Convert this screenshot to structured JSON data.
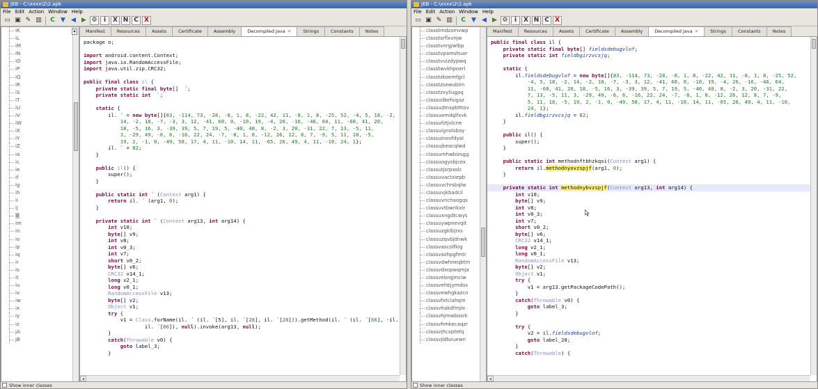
{
  "left_window": {
    "title": "JEB - C:\\xxxx\\2\\2.apk",
    "menu": [
      "File",
      "Edit",
      "Action",
      "Window",
      "Help"
    ],
    "tree_items": [
      "iK",
      "iL",
      "iM",
      "iN",
      "iO",
      "iP",
      "iQ",
      "iR",
      "iS",
      "iT",
      "iU",
      "iV",
      "iW",
      "iX",
      "iY",
      "iZ",
      "ia",
      "ic",
      "ie",
      "if",
      "ig",
      "ih",
      "ii",
      "ij",
      "il",
      "im",
      "in",
      "io",
      "ip",
      "iq",
      "ir",
      "is",
      "it",
      "iu",
      "iv",
      "iw",
      "ix",
      "iy",
      "iz",
      "jA",
      "jB"
    ],
    "tree_selected_index": 24,
    "show_inner_classes": "Show inner classes",
    "tabs": [
      "Manifest",
      "Resources",
      "Assets",
      "Certificate",
      "Assembly",
      "Decompiled Java",
      "Strings",
      "Constants",
      "Notes"
    ],
    "active_tab": 5
  },
  "right_window": {
    "title": "JEB - C:\\xxxx\\2\\2.apk",
    "menu": [
      "File",
      "Edit",
      "Action",
      "Window",
      "Help"
    ],
    "tree_items": [
      "classtmdzamvwp",
      "classtsrflxvnjw",
      "classtvnrgjwlbp",
      "classtvpamshuor",
      "classtvuizdypwq",
      "classtwvkhpoerl",
      "classtzkoemfgcl",
      "classtzsewubirn",
      "classtzvyliugpq",
      "classudkefsigaz",
      "classudmxpbhtov",
      "classuemdqlfxvk",
      "classufztjvlcne",
      "classuignolsbay",
      "classuinovfdyal",
      "classujkeacqlwd",
      "classumhwbizsgg",
      "classuogysbjcex",
      "classutjsrpxolc",
      "classuvactxiepb",
      "classuvchrsbqlw",
      "classuvjkbadcil",
      "classuvnchaogqs",
      "classuvtbwnkxir",
      "classuxngdtcwys",
      "classuywpnevqit",
      "classuzgklbjrxs",
      "classuzqvbjdnwk",
      "classvascolfkig",
      "classvazhpgfmtr",
      "classvdwhneqbtm",
      "classvdxopwqmja",
      "classvebrqjmciw",
      "classvehbjymdos",
      "classvewhgkazcn",
      "classvfxtciahqm",
      "classvhakdfmjle",
      "classvhjmwbosrk",
      "classvhmkecaqzr",
      "classvjhcxptefq",
      "classvjidbzuewn"
    ],
    "show_inner_classes": "Show inner classes",
    "tabs": [
      "Manifest",
      "Resources",
      "Assets",
      "Certificate",
      "Assembly",
      "Decompiled Java",
      "Strings",
      "Constants",
      "Notes"
    ],
    "active_tab": 5
  },
  "left_code": [
    [
      [
        "p",
        "package o;"
      ]
    ],
    [
      [
        "p",
        ""
      ]
    ],
    [
      [
        "k",
        "import"
      ],
      [
        "p",
        " android.content.Context;"
      ]
    ],
    [
      [
        "k",
        "import"
      ],
      [
        "p",
        " java.io.RandomAccessFile;"
      ]
    ],
    [
      [
        "k",
        "import"
      ],
      [
        "p",
        " java.util.zip.CRC32;"
      ]
    ],
    [
      [
        "p",
        ""
      ]
    ],
    [
      [
        "k",
        "public final class"
      ],
      [
        "p",
        " "
      ],
      [
        "t",
        "il"
      ],
      [
        "p",
        " {"
      ]
    ],
    [
      [
        "p",
        "    "
      ],
      [
        "k",
        "private static final byte"
      ],
      [
        "p",
        "[]  ´;"
      ]
    ],
    [
      [
        "p",
        "    "
      ],
      [
        "k",
        "private static int"
      ],
      [
        "p",
        "  `;"
      ]
    ],
    [
      [
        "p",
        ""
      ]
    ],
    [
      [
        "p",
        "    "
      ],
      [
        "k",
        "static"
      ],
      [
        "p",
        " {"
      ]
    ],
    [
      [
        "p",
        "        il. ´ = "
      ],
      [
        "k",
        "new byte"
      ],
      [
        "p",
        "[]{"
      ],
      [
        "n",
        "83, -114, 73, -28, -8, 1, 8, -22, 42, 11, -8, 1, 8, -25, 52, -4, 5, 18, -2,"
      ]
    ],
    [
      [
        "n",
        "            14, -2, 18, -7, -3, 3, 12, -41, 60, 0, -10, 19, -4, 26, -16, -46, 64, 11, -60, 41, 20,"
      ]
    ],
    [
      [
        "n",
        "            18, -5, 16, 3, -39, 39, 5, 7, 19, 5, -40, 40, 8, -2, 3, 20, -31, 22, 7, 13, -5, 11,"
      ]
    ],
    [
      [
        "n",
        "            3, -29, 49, -6, 6, -16, 22, 24, -7, -8, 1, 8, -12, 26, 12, 8, 7, -9, 5, 11, 18, -5,"
      ]
    ],
    [
      [
        "n",
        "            19, 2, -1, 0, -49, 58, 17, 4, 11, -10, 14, 11, -65, 26, 49, 4, 11, -10, 24, 1"
      ],
      [
        "p",
        "};"
      ]
    ],
    [
      [
        "p",
        "        il. ` = "
      ],
      [
        "n",
        "82"
      ],
      [
        "p",
        ";"
      ]
    ],
    [
      [
        "p",
        "    }"
      ]
    ],
    [
      [
        "p",
        ""
      ]
    ],
    [
      [
        "p",
        "    "
      ],
      [
        "k",
        "public"
      ],
      [
        "p",
        " "
      ],
      [
        "t",
        "il"
      ],
      [
        "p",
        "() {"
      ]
    ],
    [
      [
        "p",
        "        super();"
      ]
    ],
    [
      [
        "p",
        "    }"
      ]
    ],
    [
      [
        "p",
        ""
      ]
    ],
    [
      [
        "p",
        "    "
      ],
      [
        "k",
        "public static int"
      ],
      [
        "p",
        " ´ ("
      ],
      [
        "t",
        "Context"
      ],
      [
        "p",
        " arg1) {"
      ]
    ],
    [
      [
        "p",
        "        "
      ],
      [
        "k",
        "return"
      ],
      [
        "p",
        " il. ´ (arg1, "
      ],
      [
        "n",
        "0"
      ],
      [
        "p",
        ");"
      ]
    ],
    [
      [
        "p",
        "    }"
      ]
    ],
    [
      [
        "p",
        ""
      ]
    ],
    [
      [
        "p",
        "    "
      ],
      [
        "k",
        "private static int"
      ],
      [
        "p",
        " ´ ("
      ],
      [
        "t",
        "Context"
      ],
      [
        "p",
        " arg13, "
      ],
      [
        "k",
        "int"
      ],
      [
        "p",
        " arg14) {"
      ]
    ],
    [
      [
        "p",
        "        "
      ],
      [
        "k",
        "int"
      ],
      [
        "p",
        " v10;"
      ]
    ],
    [
      [
        "p",
        "        "
      ],
      [
        "k",
        "byte"
      ],
      [
        "p",
        "[] v9;"
      ]
    ],
    [
      [
        "p",
        "        "
      ],
      [
        "k",
        "int"
      ],
      [
        "p",
        " v8;"
      ]
    ],
    [
      [
        "p",
        "        "
      ],
      [
        "k",
        "int"
      ],
      [
        "p",
        " v0_3;"
      ]
    ],
    [
      [
        "p",
        "        "
      ],
      [
        "k",
        "int"
      ],
      [
        "p",
        " v7;"
      ]
    ],
    [
      [
        "p",
        "        "
      ],
      [
        "k",
        "short"
      ],
      [
        "p",
        " v0_2;"
      ]
    ],
    [
      [
        "p",
        "        "
      ],
      [
        "k",
        "byte"
      ],
      [
        "p",
        "[] v6;"
      ]
    ],
    [
      [
        "p",
        "        "
      ],
      [
        "t",
        "CRC32"
      ],
      [
        "p",
        " v14_1;"
      ]
    ],
    [
      [
        "p",
        "        "
      ],
      [
        "k",
        "long"
      ],
      [
        "p",
        " v2_1;"
      ]
    ],
    [
      [
        "p",
        "        "
      ],
      [
        "k",
        "long"
      ],
      [
        "p",
        " v0_1;"
      ]
    ],
    [
      [
        "p",
        "        "
      ],
      [
        "t",
        "RandomAccessFile"
      ],
      [
        "p",
        " v13;"
      ]
    ],
    [
      [
        "p",
        "        "
      ],
      [
        "k",
        "byte"
      ],
      [
        "p",
        "[] v2;"
      ]
    ],
    [
      [
        "p",
        "        "
      ],
      [
        "t",
        "Object"
      ],
      [
        "p",
        " v1;"
      ]
    ],
    [
      [
        "p",
        "        "
      ],
      [
        "k",
        "try"
      ],
      [
        "p",
        " {"
      ]
    ],
    [
      [
        "p",
        "            v1 = "
      ],
      [
        "t",
        "Class"
      ],
      [
        "p",
        ".forName(il. ´ (il. ´[5], il. ´["
      ],
      [
        "n",
        "28"
      ],
      [
        "p",
        "], il. ´["
      ],
      [
        "n",
        "28"
      ],
      [
        "p",
        "])).getMethod(il. ´ (il. ´["
      ],
      [
        "n",
        "66"
      ],
      [
        "p",
        "], -il. ´[3],"
      ]
    ],
    [
      [
        "p",
        "                    il. ´["
      ],
      [
        "n",
        "66"
      ],
      [
        "p",
        "]), "
      ],
      [
        "k",
        "null"
      ],
      [
        "p",
        ").invoke(arg13, "
      ],
      [
        "k",
        "null"
      ],
      [
        "p",
        ");"
      ]
    ],
    [
      [
        "p",
        "        }"
      ]
    ],
    [
      [
        "p",
        "        "
      ],
      [
        "k",
        "catch"
      ],
      [
        "p",
        "("
      ],
      [
        "t",
        "Throwable"
      ],
      [
        "p",
        " v0) {"
      ]
    ],
    [
      [
        "p",
        "            "
      ],
      [
        "k",
        "goto"
      ],
      [
        "p",
        " label_3;"
      ]
    ],
    [
      [
        "p",
        "        }"
      ]
    ]
  ],
  "right_code": [
    [
      [
        "k",
        "public final class"
      ],
      [
        "p",
        " il {"
      ]
    ],
    [
      [
        "p",
        "    "
      ],
      [
        "k",
        "private static final byte"
      ],
      [
        "p",
        "[] "
      ],
      [
        "f",
        "fieldsdebugvlof"
      ],
      [
        "p",
        ";"
      ]
    ],
    [
      [
        "p",
        "    "
      ],
      [
        "k",
        "private static int"
      ],
      [
        "p",
        " "
      ],
      [
        "f",
        "fieldbgirzvcsjq"
      ],
      [
        "p",
        ";"
      ]
    ],
    [
      [
        "p",
        ""
      ]
    ],
    [
      [
        "p",
        "    "
      ],
      [
        "k",
        "static"
      ],
      [
        "p",
        " {"
      ]
    ],
    [
      [
        "p",
        "        il."
      ],
      [
        "f",
        "fieldsdebugvlof"
      ],
      [
        "p",
        " = "
      ],
      [
        "k",
        "new byte"
      ],
      [
        "p",
        "[]{"
      ],
      [
        "n",
        "83, -114, 73, -28, -8, 1, 8, -22, 42, 11, -8, 1, 8, -25, 52,"
      ]
    ],
    [
      [
        "n",
        "            -4, 5, 18, -2, 14, -2, 18, -7, -3, 3, 12, -41, 60, 0, -10, 19, -4, 26, -16, -46, 64,"
      ]
    ],
    [
      [
        "n",
        "            11, -60, 41, 20, 18, -5, 16, 3, -39, 39, 5, 7, 19, 5, -40, 40, 8, -2, 3, 20, -31, 22,"
      ]
    ],
    [
      [
        "n",
        "            7, 13, -5, 11, 3, -29, 49, -6, 6, -16, 22, 24, -7, -8, 1, 8, -12, 26, 12, 8, 7, -9,"
      ]
    ],
    [
      [
        "n",
        "            5, 11, 18, -5, 19, 2, -1, 0, -49, 58, 17, 4, 11, -10, 14, 11, -65, 26, 49, 4, 11, -10,"
      ]
    ],
    [
      [
        "n",
        "            24, 1"
      ],
      [
        "p",
        "};"
      ]
    ],
    [
      [
        "p",
        "        il."
      ],
      [
        "f",
        "fieldbgirzvcsjq"
      ],
      [
        "p",
        " = "
      ],
      [
        "n",
        "82"
      ],
      [
        "p",
        ";"
      ]
    ],
    [
      [
        "p",
        "    }"
      ]
    ],
    [
      [
        "p",
        ""
      ]
    ],
    [
      [
        "p",
        "    "
      ],
      [
        "k",
        "public"
      ],
      [
        "p",
        " il() {"
      ]
    ],
    [
      [
        "p",
        "        super();"
      ]
    ],
    [
      [
        "p",
        "    }"
      ]
    ],
    [
      [
        "p",
        ""
      ]
    ],
    [
      [
        "p",
        "    "
      ],
      [
        "k",
        "public static int"
      ],
      [
        "p",
        " methodnftbhzkqsi("
      ],
      [
        "t",
        "Context"
      ],
      [
        "p",
        " arg1) {"
      ]
    ],
    [
      [
        "p",
        "        "
      ],
      [
        "k",
        "return"
      ],
      [
        "p",
        " il."
      ],
      [
        "h",
        "methodnyovzspjf"
      ],
      [
        "p",
        "(arg1, "
      ],
      [
        "n",
        "0"
      ],
      [
        "p",
        ");"
      ]
    ],
    [
      [
        "p",
        "    }"
      ]
    ],
    [
      [
        "p",
        ""
      ]
    ],
    [
      [
        "C",
        ""
      ],
      [
        "p",
        "    "
      ],
      [
        "k",
        "private static int"
      ],
      [
        "p",
        " "
      ],
      [
        "h",
        "methodnybvzspjf"
      ],
      [
        "p",
        "("
      ],
      [
        "t",
        "Context"
      ],
      [
        "p",
        " arg13, "
      ],
      [
        "k",
        "int"
      ],
      [
        "p",
        " arg14) {"
      ]
    ],
    [
      [
        "p",
        "        "
      ],
      [
        "k",
        "int"
      ],
      [
        "p",
        " v10;"
      ]
    ],
    [
      [
        "p",
        "        "
      ],
      [
        "k",
        "byte"
      ],
      [
        "p",
        "[] v9;"
      ]
    ],
    [
      [
        "p",
        "        "
      ],
      [
        "k",
        "int"
      ],
      [
        "p",
        " v8;"
      ]
    ],
    [
      [
        "p",
        "        "
      ],
      [
        "k",
        "int"
      ],
      [
        "p",
        " v0_3;"
      ]
    ],
    [
      [
        "p",
        "        "
      ],
      [
        "k",
        "int"
      ],
      [
        "p",
        " v7;"
      ]
    ],
    [
      [
        "p",
        "        "
      ],
      [
        "k",
        "short"
      ],
      [
        "p",
        " v0_2;"
      ]
    ],
    [
      [
        "p",
        "        "
      ],
      [
        "k",
        "byte"
      ],
      [
        "p",
        "[] v6;"
      ]
    ],
    [
      [
        "p",
        "        "
      ],
      [
        "t",
        "CRC32"
      ],
      [
        "p",
        " v14_1;"
      ]
    ],
    [
      [
        "p",
        "        "
      ],
      [
        "k",
        "long"
      ],
      [
        "p",
        " v2_1;"
      ]
    ],
    [
      [
        "p",
        "        "
      ],
      [
        "k",
        "long"
      ],
      [
        "p",
        " v0_1;"
      ]
    ],
    [
      [
        "p",
        "        "
      ],
      [
        "t",
        "RandomAccessFile"
      ],
      [
        "p",
        " v13;"
      ]
    ],
    [
      [
        "p",
        "        "
      ],
      [
        "k",
        "byte"
      ],
      [
        "p",
        "[] v2;"
      ]
    ],
    [
      [
        "p",
        "        "
      ],
      [
        "t",
        "Object"
      ],
      [
        "p",
        " v1;"
      ]
    ],
    [
      [
        "p",
        "        "
      ],
      [
        "k",
        "try"
      ],
      [
        "p",
        " {"
      ]
    ],
    [
      [
        "p",
        "            v1 = arg13.getPackageCodePath();"
      ]
    ],
    [
      [
        "p",
        "        }"
      ]
    ],
    [
      [
        "p",
        "        "
      ],
      [
        "k",
        "catch"
      ],
      [
        "p",
        "("
      ],
      [
        "t",
        "Throwable"
      ],
      [
        "p",
        " v0) {"
      ]
    ],
    [
      [
        "p",
        "            "
      ],
      [
        "k",
        "goto"
      ],
      [
        "p",
        " label_3;"
      ]
    ],
    [
      [
        "p",
        "        }"
      ]
    ],
    [
      [
        "p",
        ""
      ]
    ],
    [
      [
        "p",
        "        "
      ],
      [
        "k",
        "try"
      ],
      [
        "p",
        " {"
      ]
    ],
    [
      [
        "p",
        "            v2 = il."
      ],
      [
        "f",
        "fieldsdebugvlof"
      ],
      [
        "p",
        ";"
      ]
    ],
    [
      [
        "p",
        "            "
      ],
      [
        "k",
        "goto"
      ],
      [
        "p",
        " label_28;"
      ]
    ],
    [
      [
        "p",
        "        }"
      ]
    ],
    [
      [
        "p",
        "        "
      ],
      [
        "k",
        "catch"
      ],
      [
        "p",
        "("
      ],
      [
        "t",
        "Throwable"
      ],
      [
        "p",
        ") {"
      ]
    ]
  ]
}
